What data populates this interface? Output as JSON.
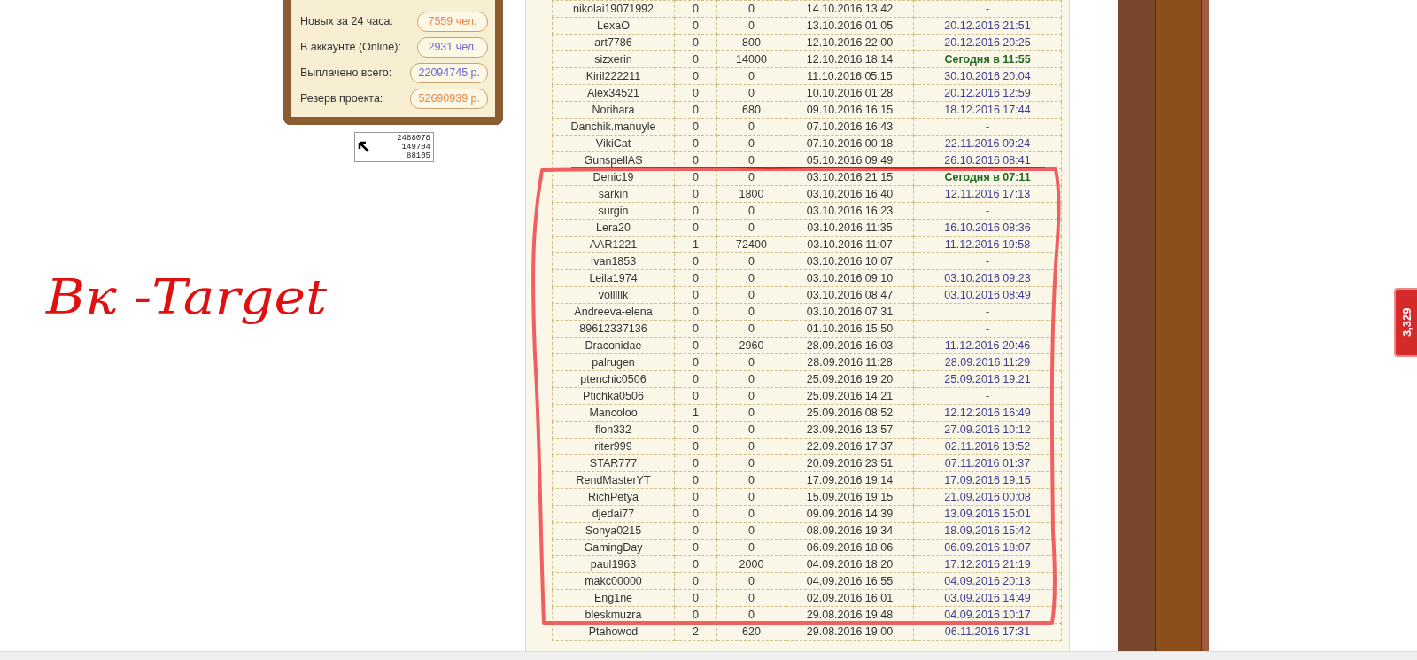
{
  "stats_panel": {
    "items": [
      {
        "label": "Новых за 24 часа:",
        "value": "7559 чел.",
        "color": "#e8884a"
      },
      {
        "label": "В аккаунте (Online):",
        "value": "2931 чел.",
        "color": "#6a6ad0"
      },
      {
        "label": "Выплачено всего:",
        "value": "22094745 р.",
        "color": "#6a6ad0"
      },
      {
        "label": "Резерв проекта:",
        "value": "52690939 р.",
        "color": "#e8884a"
      }
    ]
  },
  "counter": {
    "lines": [
      "2488078",
      "149704",
      "88105"
    ]
  },
  "annotation": {
    "text": "Вк -Target"
  },
  "table": {
    "rows": [
      {
        "name": "nikolai19071992",
        "c2": "0",
        "c3": "0",
        "registered": "14.10.2016 13:42",
        "last": "-",
        "kind": "none"
      },
      {
        "name": "LexaO",
        "c2": "0",
        "c3": "0",
        "registered": "13.10.2016 01:05",
        "last": "20.12.2016 21:51",
        "kind": "date"
      },
      {
        "name": "art7786",
        "c2": "0",
        "c3": "800",
        "registered": "12.10.2016 22:00",
        "last": "20.12.2016 20:25",
        "kind": "date"
      },
      {
        "name": "sizxerin",
        "c2": "0",
        "c3": "14000",
        "registered": "12.10.2016 18:14",
        "last": "Сегодня в 11:55",
        "kind": "today"
      },
      {
        "name": "Kiril222211",
        "c2": "0",
        "c3": "0",
        "registered": "11.10.2016 05:15",
        "last": "30.10.2016 20:04",
        "kind": "date"
      },
      {
        "name": "Alex34521",
        "c2": "0",
        "c3": "0",
        "registered": "10.10.2016 01:28",
        "last": "20.12.2016 12:59",
        "kind": "date"
      },
      {
        "name": "Norihara",
        "c2": "0",
        "c3": "680",
        "registered": "09.10.2016 16:15",
        "last": "18.12.2016 17:44",
        "kind": "date"
      },
      {
        "name": "Danchik.manuyle",
        "c2": "0",
        "c3": "0",
        "registered": "07.10.2016 16:43",
        "last": "-",
        "kind": "none"
      },
      {
        "name": "VikiCat",
        "c2": "0",
        "c3": "0",
        "registered": "07.10.2016 00:18",
        "last": "22.11.2016 09:24",
        "kind": "date"
      },
      {
        "name": "GunspellAS",
        "c2": "0",
        "c3": "0",
        "registered": "05.10.2016 09:49",
        "last": "26.10.2016 08:41",
        "kind": "date"
      },
      {
        "name": "Denic19",
        "c2": "0",
        "c3": "0",
        "registered": "03.10.2016 21:15",
        "last": "Сегодня в 07:11",
        "kind": "today"
      },
      {
        "name": "sarkin",
        "c2": "0",
        "c3": "1800",
        "registered": "03.10.2016 16:40",
        "last": "12.11.2016 17:13",
        "kind": "date"
      },
      {
        "name": "surgin",
        "c2": "0",
        "c3": "0",
        "registered": "03.10.2016 16:23",
        "last": "-",
        "kind": "none"
      },
      {
        "name": "Lera20",
        "c2": "0",
        "c3": "0",
        "registered": "03.10.2016 11:35",
        "last": "16.10.2016 08:36",
        "kind": "date"
      },
      {
        "name": "AAR1221",
        "c2": "1",
        "c3": "72400",
        "registered": "03.10.2016 11:07",
        "last": "11.12.2016 19:58",
        "kind": "date"
      },
      {
        "name": "Ivan1853",
        "c2": "0",
        "c3": "0",
        "registered": "03.10.2016 10:07",
        "last": "-",
        "kind": "none"
      },
      {
        "name": "Leila1974",
        "c2": "0",
        "c3": "0",
        "registered": "03.10.2016 09:10",
        "last": "03.10.2016 09:23",
        "kind": "date"
      },
      {
        "name": "volllllk",
        "c2": "0",
        "c3": "0",
        "registered": "03.10.2016 08:47",
        "last": "03.10.2016 08:49",
        "kind": "date"
      },
      {
        "name": "Andreeva-elena",
        "c2": "0",
        "c3": "0",
        "registered": "03.10.2016 07:31",
        "last": "-",
        "kind": "none"
      },
      {
        "name": "89612337136",
        "c2": "0",
        "c3": "0",
        "registered": "01.10.2016 15:50",
        "last": "-",
        "kind": "none"
      },
      {
        "name": "Draconidae",
        "c2": "0",
        "c3": "2960",
        "registered": "28.09.2016 16:03",
        "last": "11.12.2016 20:46",
        "kind": "date"
      },
      {
        "name": "palrugen",
        "c2": "0",
        "c3": "0",
        "registered": "28.09.2016 11:28",
        "last": "28.09.2016 11:29",
        "kind": "date"
      },
      {
        "name": "ptenchic0506",
        "c2": "0",
        "c3": "0",
        "registered": "25.09.2016 19:20",
        "last": "25.09.2016 19:21",
        "kind": "date"
      },
      {
        "name": "Ptichka0506",
        "c2": "0",
        "c3": "0",
        "registered": "25.09.2016 14:21",
        "last": "-",
        "kind": "none"
      },
      {
        "name": "Mancoloo",
        "c2": "1",
        "c3": "0",
        "registered": "25.09.2016 08:52",
        "last": "12.12.2016 16:49",
        "kind": "date"
      },
      {
        "name": "flon332",
        "c2": "0",
        "c3": "0",
        "registered": "23.09.2016 13:57",
        "last": "27.09.2016 10:12",
        "kind": "date"
      },
      {
        "name": "riter999",
        "c2": "0",
        "c3": "0",
        "registered": "22.09.2016 17:37",
        "last": "02.11.2016 13:52",
        "kind": "date"
      },
      {
        "name": "STAR777",
        "c2": "0",
        "c3": "0",
        "registered": "20.09.2016 23:51",
        "last": "07.11.2016 01:37",
        "kind": "date"
      },
      {
        "name": "RendMasterYT",
        "c2": "0",
        "c3": "0",
        "registered": "17.09.2016 19:14",
        "last": "17.09.2016 19:15",
        "kind": "date"
      },
      {
        "name": "RichPetya",
        "c2": "0",
        "c3": "0",
        "registered": "15.09.2016 19:15",
        "last": "21.09.2016 00:08",
        "kind": "date"
      },
      {
        "name": "djedai77",
        "c2": "0",
        "c3": "0",
        "registered": "09.09.2016 14:39",
        "last": "13.09.2016 15:01",
        "kind": "date"
      },
      {
        "name": "Sonya0215",
        "c2": "0",
        "c3": "0",
        "registered": "08.09.2016 19:34",
        "last": "18.09.2016 15:42",
        "kind": "date"
      },
      {
        "name": "GamingDay",
        "c2": "0",
        "c3": "0",
        "registered": "06.09.2016 18:06",
        "last": "06.09.2016 18:07",
        "kind": "date"
      },
      {
        "name": "paul1963",
        "c2": "0",
        "c3": "2000",
        "registered": "04.09.2016 18:20",
        "last": "17.12.2016 21:19",
        "kind": "date"
      },
      {
        "name": "makc00000",
        "c2": "0",
        "c3": "0",
        "registered": "04.09.2016 16:55",
        "last": "04.09.2016 20:13",
        "kind": "date"
      },
      {
        "name": "Eng1ne",
        "c2": "0",
        "c3": "0",
        "registered": "02.09.2016 16:01",
        "last": "03.09.2016 14:49",
        "kind": "date"
      },
      {
        "name": "bleskmuzra",
        "c2": "0",
        "c3": "0",
        "registered": "29.08.2016 19:48",
        "last": "04.09.2016 10:17",
        "kind": "date"
      },
      {
        "name": "Ptahowod",
        "c2": "2",
        "c3": "620",
        "registered": "29.08.2016 19:00",
        "last": "06.11.2016 17:31",
        "kind": "date"
      }
    ]
  },
  "side_badge": {
    "text": "3,329"
  }
}
